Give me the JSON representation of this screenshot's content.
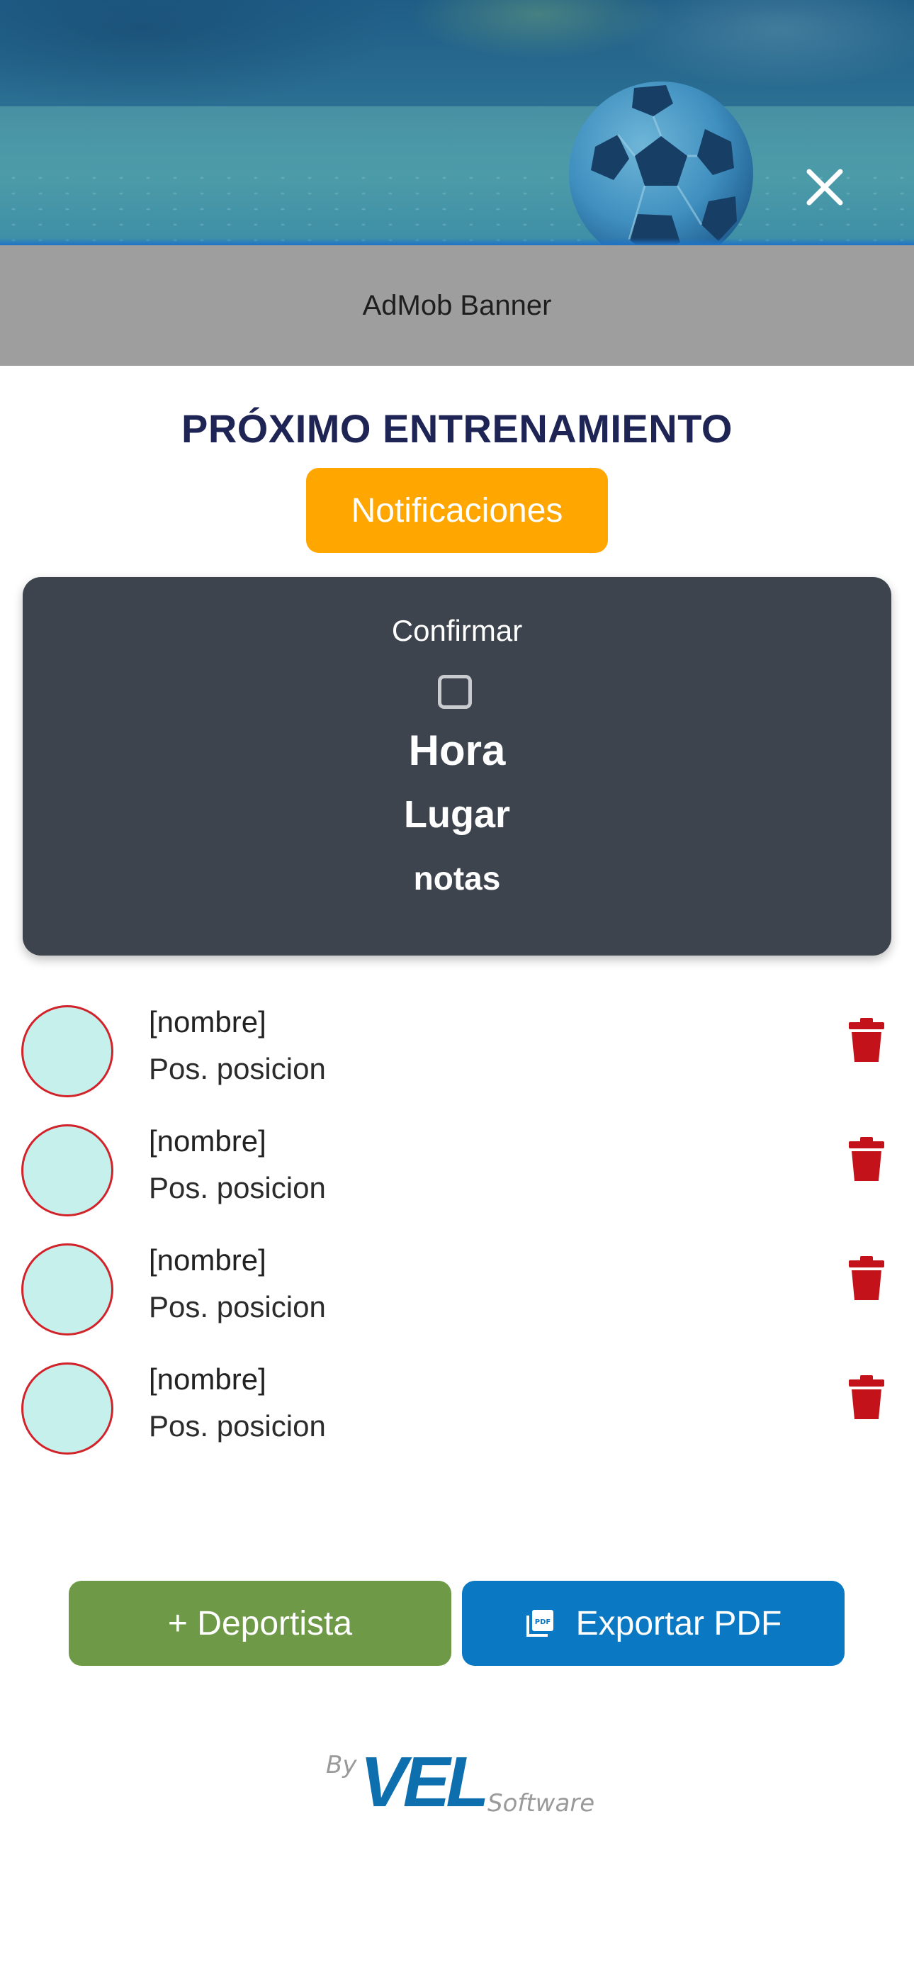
{
  "header": {
    "image_alt": "soccer-ball-on-field",
    "close_icon": "close-icon"
  },
  "admob": {
    "label": "AdMob Banner"
  },
  "page": {
    "title": "PRÓXIMO ENTRENAMIENTO",
    "notifications_label": "Notificaciones"
  },
  "training": {
    "confirm_label": "Confirmar",
    "confirmed": false,
    "hora": "Hora",
    "lugar": "Lugar",
    "notas": "notas"
  },
  "players": [
    {
      "name": "[nombre]",
      "position": "Pos. posicion"
    },
    {
      "name": "[nombre]",
      "position": "Pos. posicion"
    },
    {
      "name": "[nombre]",
      "position": "Pos. posicion"
    },
    {
      "name": "[nombre]",
      "position": "Pos. posicion"
    }
  ],
  "actions": {
    "add_label": "+ Deportista",
    "export_label": "Exportar PDF"
  },
  "footer": {
    "by": "By",
    "brand": "VEL",
    "software": "Software"
  },
  "colors": {
    "title": "#1e2555",
    "notifications": "#ffa600",
    "card": "#3e444d",
    "avatar_fill": "#c5f0eb",
    "avatar_border": "#d3222a",
    "trash": "#c4121a",
    "add_button": "#6e9a47",
    "export_button": "#0a78c2",
    "brand": "#0e6fae"
  }
}
